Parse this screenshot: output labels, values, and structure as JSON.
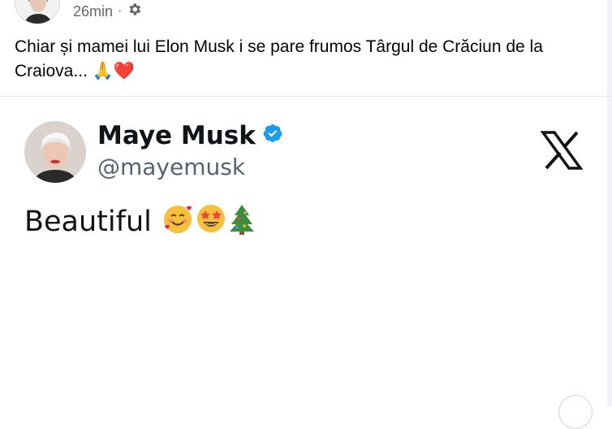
{
  "post": {
    "time": "26min",
    "separator": "·",
    "privacy_icon": "gear-icon",
    "text": "Chiar și mamei lui Elon Musk i se pare frumos Târgul de Crăciun de la Craiova... 🙏❤️",
    "emoji_icons": [
      "folded-hands-icon",
      "red-heart-icon"
    ]
  },
  "tweet": {
    "name": "Maye Musk",
    "handle": "@mayemusk",
    "verified_icon": "verified-badge-icon",
    "platform_icon": "x-logo-icon",
    "body_text": "Beautiful",
    "body_emoji_icons": [
      "smiling-face-with-hearts-icon",
      "star-struck-icon",
      "christmas-tree-icon"
    ]
  },
  "colors": {
    "text": "#050505",
    "meta": "#65676b",
    "verified": "#1d9bf0",
    "tweet_text": "#0f1419",
    "tweet_handle": "#536471"
  }
}
